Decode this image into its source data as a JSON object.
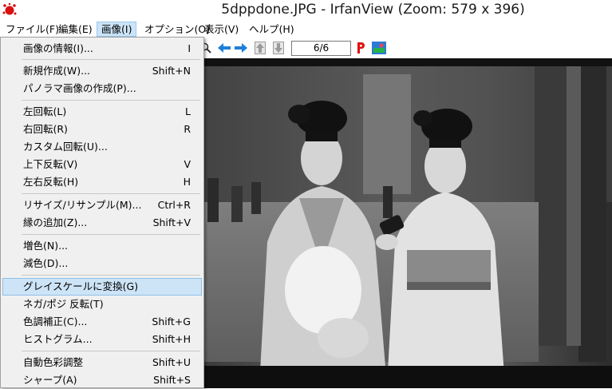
{
  "window": {
    "title": "5dppdone.JPG - IrfanView (Zoom: 579 x 396)"
  },
  "menubar": {
    "items": [
      {
        "label": "ファイル(F)",
        "active": false
      },
      {
        "label": "編集(E)",
        "active": false
      },
      {
        "label": "画像(I)",
        "active": true
      },
      {
        "label": "オプション(O)",
        "active": false
      },
      {
        "label": "表示(V)",
        "active": false
      },
      {
        "label": "ヘルプ(H)",
        "active": false
      }
    ]
  },
  "toolbar": {
    "page": "6/6",
    "icons": [
      "zoom-icon",
      "arrow-left-icon",
      "arrow-right-icon",
      "arrow-up-icon",
      "arrow-down-icon",
      "paint-p-icon",
      "thumbnail-icon"
    ]
  },
  "image_menu": {
    "items": [
      {
        "label": "画像の情報(I)...",
        "shortcut": "I"
      },
      {
        "label": "新規作成(W)...",
        "shortcut": "Shift+N"
      },
      {
        "label": "パノラマ画像の作成(P)...",
        "shortcut": ""
      },
      {
        "label": "左回転(L)",
        "shortcut": "L"
      },
      {
        "label": "右回転(R)",
        "shortcut": "R"
      },
      {
        "label": "カスタム回転(U)...",
        "shortcut": ""
      },
      {
        "label": "上下反転(V)",
        "shortcut": "V"
      },
      {
        "label": "左右反転(H)",
        "shortcut": "H"
      },
      {
        "label": "リサイズ/リサンプル(M)...",
        "shortcut": "Ctrl+R"
      },
      {
        "label": "縁の追加(Z)...",
        "shortcut": "Shift+V"
      },
      {
        "label": "増色(N)...",
        "shortcut": ""
      },
      {
        "label": "減色(D)...",
        "shortcut": ""
      },
      {
        "label": "グレイスケールに変換(G)",
        "shortcut": ""
      },
      {
        "label": "ネガ/ポジ 反転(T)",
        "shortcut": ""
      },
      {
        "label": "色調補正(C)...",
        "shortcut": "Shift+G"
      },
      {
        "label": "ヒストグラム...",
        "shortcut": "Shift+H"
      },
      {
        "label": "自動色彩調整",
        "shortcut": "Shift+U"
      },
      {
        "label": "シャープ(A)",
        "shortcut": "Shift+S"
      }
    ]
  },
  "colors": {
    "menu_highlight": "#cde4f7",
    "menu_highlight_border": "#8fbfe6",
    "accent_red": "#e01010"
  }
}
